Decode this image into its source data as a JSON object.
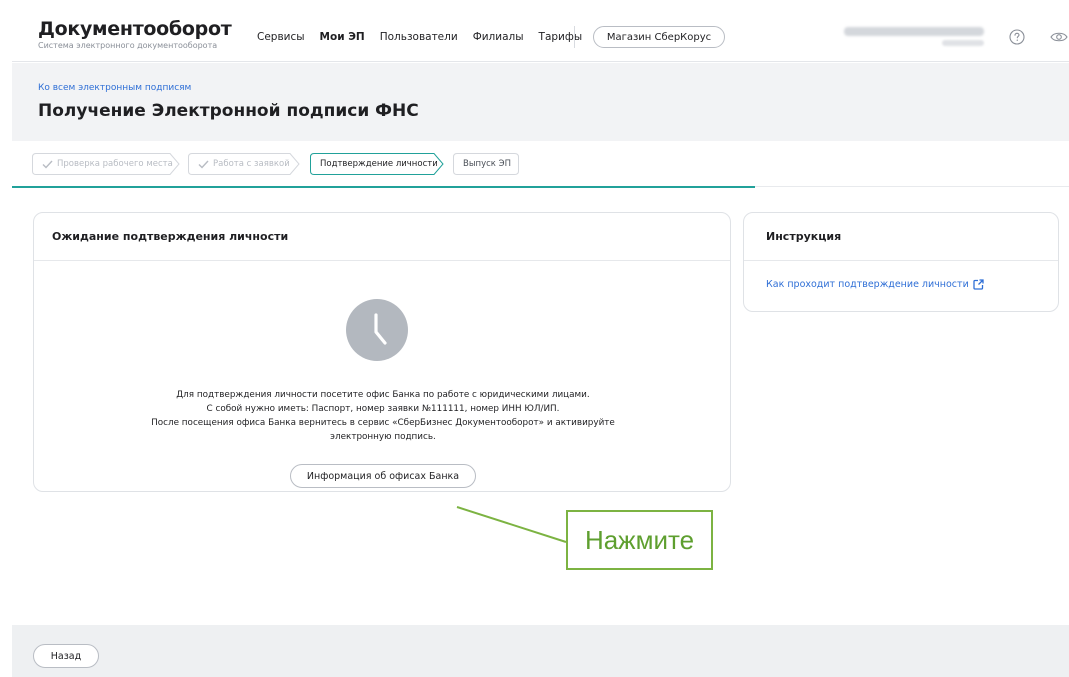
{
  "header": {
    "logo_title": "Документооборот",
    "logo_subtitle": "Система электронного документооборота",
    "nav": [
      {
        "label": "Сервисы",
        "active": false
      },
      {
        "label": "Мои ЭП",
        "active": true
      },
      {
        "label": "Пользователи",
        "active": false
      },
      {
        "label": "Филиалы",
        "active": false
      },
      {
        "label": "Тарифы",
        "active": false
      }
    ],
    "shop_button": "Магазин СберКорус",
    "help_icon": "question-circle-icon",
    "eye_icon": "eye-icon"
  },
  "title_band": {
    "back_link": "Ко всем электронным подписям",
    "title": "Получение Электронной подписи ФНС"
  },
  "stepper": {
    "steps": [
      {
        "label": "Проверка рабочего места",
        "state": "done"
      },
      {
        "label": "Работа с заявкой",
        "state": "done"
      },
      {
        "label": "Подтверждение личности",
        "state": "current"
      },
      {
        "label": "Выпуск ЭП",
        "state": "next"
      }
    ],
    "accent": "#21a19a"
  },
  "main_card": {
    "title": "Ожидание подтверждения личности",
    "icon": "clock-icon",
    "message_lines": [
      "Для подтверждения личности посетите офис Банка по работе с юридическими лицами.",
      "С собой нужно иметь: Паспорт, номер заявки №111111, номер ИНН ЮЛ/ИП.",
      "После посещения офиса Банка вернитесь в сервис «СберБизнес Документооборот» и активируйте",
      "электронную подпись."
    ],
    "button": "Информация об офисах Банка"
  },
  "side_card": {
    "title": "Инструкция",
    "link": "Как проходит подтверждение личности",
    "link_icon": "external-link-icon"
  },
  "annotation": {
    "text": "Нажмите",
    "color": "#7cb342"
  },
  "footer": {
    "back_button": "Назад"
  },
  "colors": {
    "link": "#2f6fd6",
    "band": "#f2f3f5",
    "clock": "#b3b8bf"
  }
}
